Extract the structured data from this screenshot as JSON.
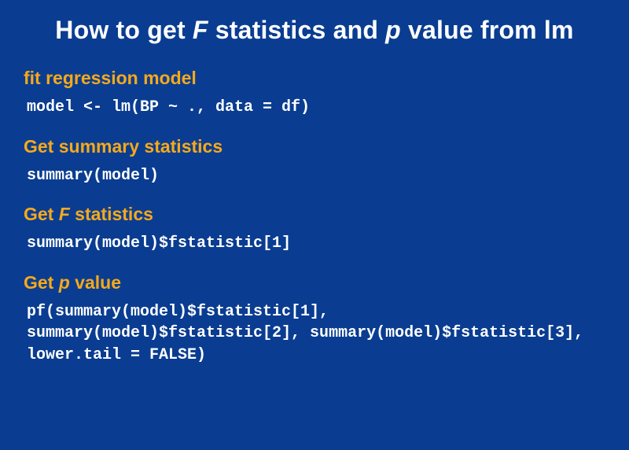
{
  "title": {
    "pre": "How to get ",
    "f": "F",
    "mid": " statistics and ",
    "p": "p",
    "post": " value from lm"
  },
  "sections": {
    "fit": {
      "heading": "fit regression model",
      "code": "model <- lm(BP ~ ., data = df)"
    },
    "summary": {
      "heading": "Get summary statistics",
      "code": "summary(model)"
    },
    "fstat": {
      "heading_pre": "Get ",
      "heading_f": "F",
      "heading_post": " statistics",
      "code": "summary(model)$fstatistic[1]"
    },
    "pval": {
      "heading_pre": "Get ",
      "heading_p": "p",
      "heading_post": " value",
      "code": "pf(summary(model)$fstatistic[1], summary(model)$fstatistic[2], summary(model)$fstatistic[3], lower.tail = FALSE)"
    }
  }
}
